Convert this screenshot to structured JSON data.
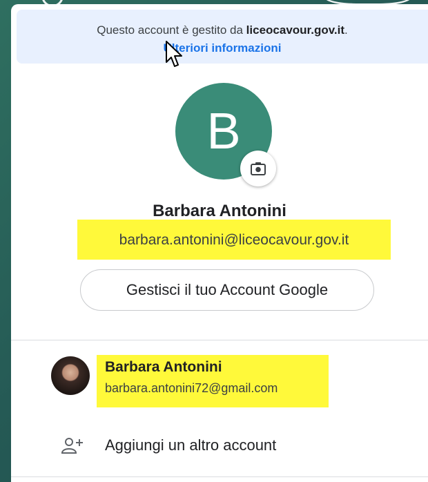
{
  "banner": {
    "managed_prefix": "Questo account è gestito da ",
    "managed_domain": "liceocavour.gov.it",
    "managed_suffix": ".",
    "learn_more": "Ulteriori informazioni"
  },
  "account": {
    "initial": "B",
    "name": "Barbara Antonini",
    "email": "barbara.antonini@liceocavour.gov.it",
    "avatar_color": "#3a8c78",
    "manage_label": "Gestisci il tuo Account Google"
  },
  "other_account": {
    "name": "Barbara Antonini",
    "email": "barbara.antonini72@gmail.com"
  },
  "add_account": {
    "label": "Aggiungi un altro account"
  },
  "colors": {
    "highlight": "#fff93a",
    "link": "#1a73e8",
    "banner_bg": "#e8f0fe"
  },
  "icons": [
    "camera-icon",
    "add-person-icon",
    "mouse-cursor-icon"
  ]
}
